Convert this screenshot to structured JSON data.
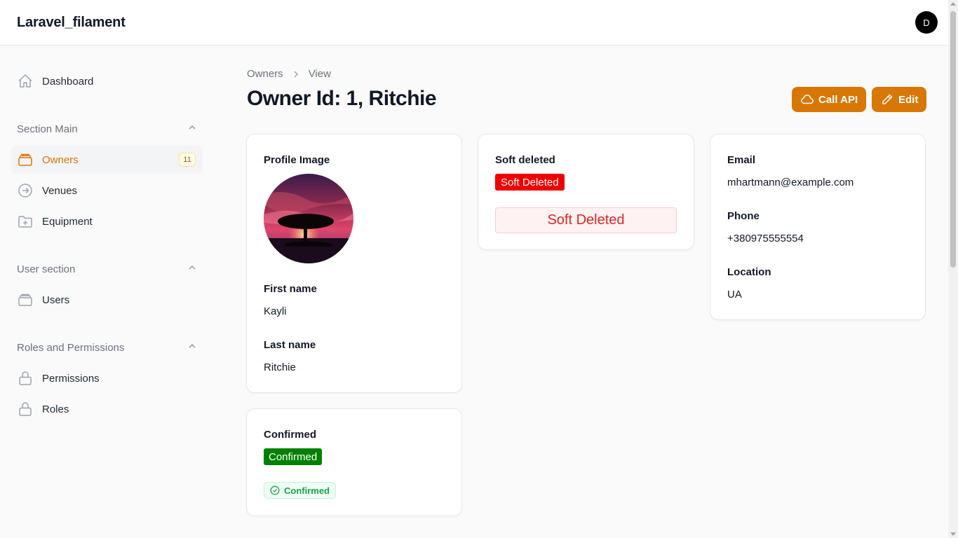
{
  "app": {
    "title": "Laravel_filament",
    "user_initial": "D"
  },
  "sidebar": {
    "dashboard": "Dashboard",
    "groups": [
      {
        "label": "Section Main",
        "items": [
          {
            "label": "Owners",
            "badge": "11",
            "icon": "owners-icon",
            "active": true
          },
          {
            "label": "Venues",
            "icon": "arrow-circle-icon"
          },
          {
            "label": "Equipment",
            "icon": "folder-plus-icon"
          }
        ]
      },
      {
        "label": "User section",
        "items": [
          {
            "label": "Users",
            "icon": "stack-icon"
          }
        ]
      },
      {
        "label": "Roles and Permissions",
        "items": [
          {
            "label": "Permissions",
            "icon": "lock-icon"
          },
          {
            "label": "Roles",
            "icon": "lock-icon"
          }
        ]
      }
    ]
  },
  "breadcrumb": {
    "parent": "Owners",
    "current": "View"
  },
  "page": {
    "title": "Owner Id: 1, Ritchie"
  },
  "actions": {
    "call_api": "Call API",
    "edit": "Edit"
  },
  "profile_card": {
    "image_label": "Profile Image",
    "first_name_label": "First name",
    "first_name": "Kayli",
    "last_name_label": "Last name",
    "last_name": "Ritchie"
  },
  "soft_deleted_card": {
    "label": "Soft deleted",
    "badge": "Soft Deleted",
    "box_text": "Soft Deleted",
    "badge_color": "#ef0000"
  },
  "contact_card": {
    "email_label": "Email",
    "email": "mhartmann@example.com",
    "phone_label": "Phone",
    "phone": "+380975555554",
    "location_label": "Location",
    "location": "UA"
  },
  "confirmed_card": {
    "label": "Confirmed",
    "badge": "Confirmed",
    "pill": "Confirmed",
    "badge_color": "#008000"
  },
  "colors": {
    "accent": "#d97706"
  }
}
